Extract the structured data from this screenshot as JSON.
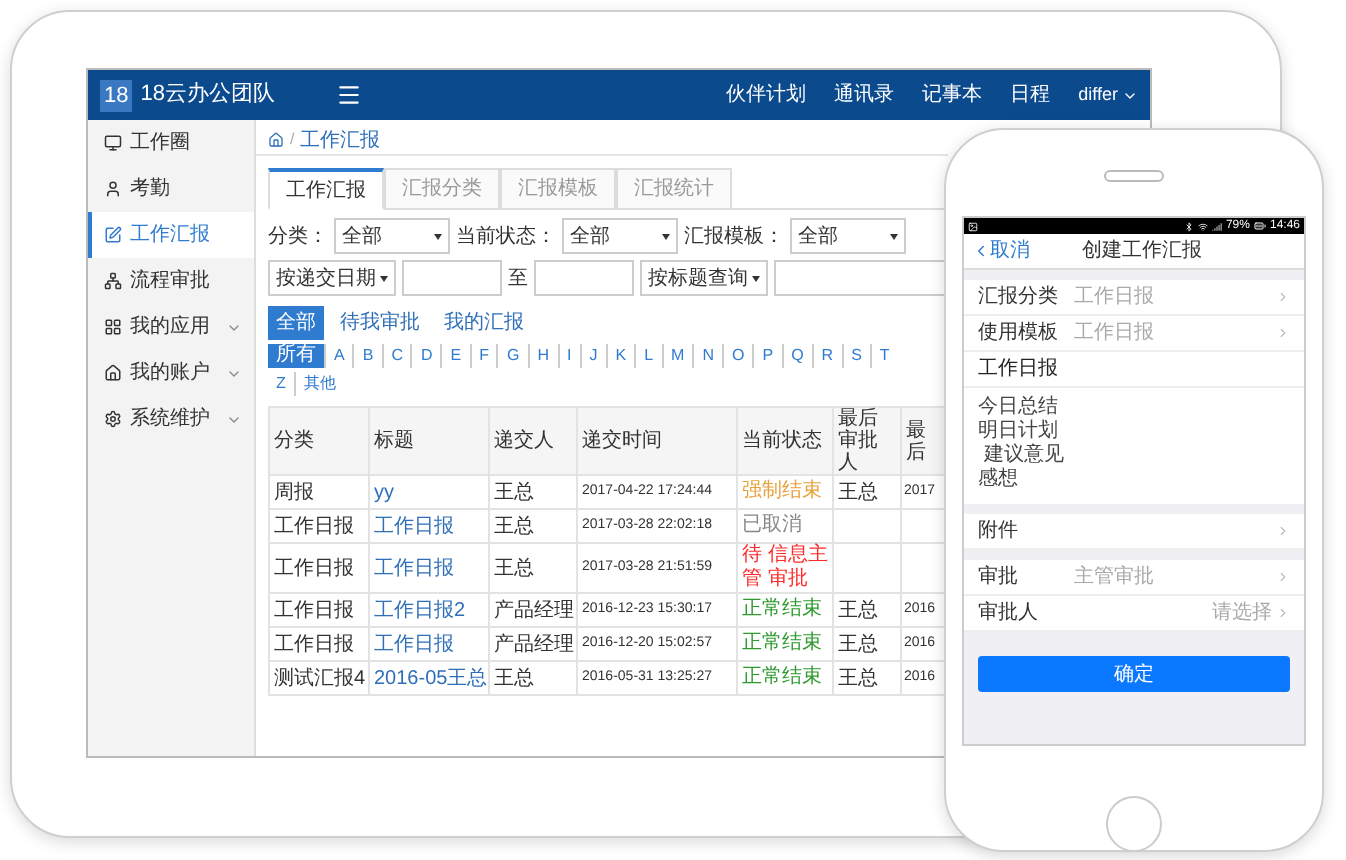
{
  "tablet": {
    "logo_badge": "18",
    "app_name": "18云办公团队",
    "nav_links": [
      "伙伴计划",
      "通讯录",
      "记事本",
      "日程"
    ],
    "user_menu": "differ",
    "sidebar": [
      {
        "label": "工作圈",
        "selected": false,
        "expandable": false
      },
      {
        "label": "考勤",
        "selected": false,
        "expandable": false
      },
      {
        "label": "工作汇报",
        "selected": true,
        "expandable": false
      },
      {
        "label": "流程审批",
        "selected": false,
        "expandable": false
      },
      {
        "label": "我的应用",
        "selected": false,
        "expandable": true
      },
      {
        "label": "我的账户",
        "selected": false,
        "expandable": true
      },
      {
        "label": "系统维护",
        "selected": false,
        "expandable": true
      }
    ],
    "breadcrumb_separator": "/",
    "breadcrumb": "工作汇报",
    "tabs": [
      {
        "label": "工作汇报",
        "selected": true
      },
      {
        "label": "汇报分类",
        "selected": false
      },
      {
        "label": "汇报模板",
        "selected": false
      },
      {
        "label": "汇报统计",
        "selected": false
      }
    ],
    "filters": [
      {
        "label": "分类：",
        "value": "全部"
      },
      {
        "label": "当前状态：",
        "value": "全部"
      },
      {
        "label": "汇报模板：",
        "value": "全部"
      }
    ],
    "date_filter": {
      "mode": "按递交日期",
      "separator": "至",
      "search_mode": "按标题查询"
    },
    "scope_buttons": [
      {
        "label": "全部",
        "selected": true
      },
      {
        "label": "待我审批",
        "selected": false
      },
      {
        "label": "我的汇报",
        "selected": false
      }
    ],
    "letters": [
      {
        "label": "所有",
        "selected": true
      },
      {
        "label": "A",
        "selected": false
      },
      {
        "label": "B",
        "selected": false
      },
      {
        "label": "C",
        "selected": false
      },
      {
        "label": "D",
        "selected": false
      },
      {
        "label": "E",
        "selected": false
      },
      {
        "label": "F",
        "selected": false
      },
      {
        "label": "G",
        "selected": false
      },
      {
        "label": "H",
        "selected": false
      },
      {
        "label": "I",
        "selected": false
      },
      {
        "label": "J",
        "selected": false
      },
      {
        "label": "K",
        "selected": false
      },
      {
        "label": "L",
        "selected": false
      },
      {
        "label": "M",
        "selected": false
      },
      {
        "label": "N",
        "selected": false
      },
      {
        "label": "O",
        "selected": false
      },
      {
        "label": "P",
        "selected": false
      },
      {
        "label": "Q",
        "selected": false
      },
      {
        "label": "R",
        "selected": false
      },
      {
        "label": "S",
        "selected": false
      },
      {
        "label": "T",
        "selected": false
      }
    ],
    "letters_wrapped": [
      {
        "label": "Z",
        "selected": false
      },
      {
        "label": "其他",
        "selected": false
      }
    ],
    "table": {
      "columns": [
        "分类",
        "标题",
        "递交人",
        "递交时间",
        "当前状态",
        "最后审批人",
        "最后"
      ],
      "rows": [
        {
          "category": "周报",
          "title": "yy",
          "submitter": "王总",
          "time": "2017-04-22 17:24:44",
          "status": "强制结束",
          "color": "#e8a13a",
          "approver": "王总",
          "column_7": "2017"
        },
        {
          "category": "工作日报",
          "title": "工作日报",
          "submitter": "王总",
          "time": "2017-03-28 22:02:18",
          "status": "已取消",
          "color": "#888888"
        },
        {
          "category": "工作日报",
          "title": "工作日报",
          "submitter": "王总",
          "time": "2017-03-28 21:51:59",
          "status": "待 信息主管 审批",
          "color": "#ff2a2a"
        },
        {
          "category": "工作日报",
          "title": "工作日报2",
          "submitter": "产品经理",
          "time": "2016-12-23 15:30:17",
          "status": "正常结束",
          "color": "#2e9a2e",
          "approver": "王总",
          "column_7": "2016"
        },
        {
          "category": "工作日报",
          "title": "工作日报",
          "submitter": "产品经理",
          "time": "2016-12-20 15:02:57",
          "status": "正常结束",
          "color": "#2e9a2e",
          "approver": "王总",
          "column_7": "2016"
        },
        {
          "category": "测试汇报4",
          "title": "2016-05王总",
          "submitter": "王总",
          "time": "2016-05-31 13:25:27",
          "status": "正常结束",
          "color": "#2e9a2e",
          "approver": "王总",
          "column_7": "2016"
        }
      ]
    }
  },
  "phone": {
    "battery": "79%",
    "time": "14:46",
    "back": "取消",
    "title": "创建工作汇报",
    "groups": [
      [
        {
          "kind": "select",
          "label": "汇报分类",
          "value": "工作日报"
        },
        {
          "kind": "select",
          "label": "使用模板",
          "value": "工作日报"
        },
        {
          "kind": "heading",
          "label": "工作日报"
        },
        {
          "kind": "text",
          "lines": [
            "今日总结",
            "明日计划",
            " 建议意见",
            "感想"
          ]
        }
      ],
      [
        {
          "kind": "select",
          "label": "附件"
        }
      ],
      [
        {
          "kind": "select",
          "label": "审批",
          "value": "主管审批"
        },
        {
          "kind": "picker",
          "label": "审批人",
          "placeholder": "请选择"
        }
      ]
    ],
    "confirm": "确定"
  }
}
